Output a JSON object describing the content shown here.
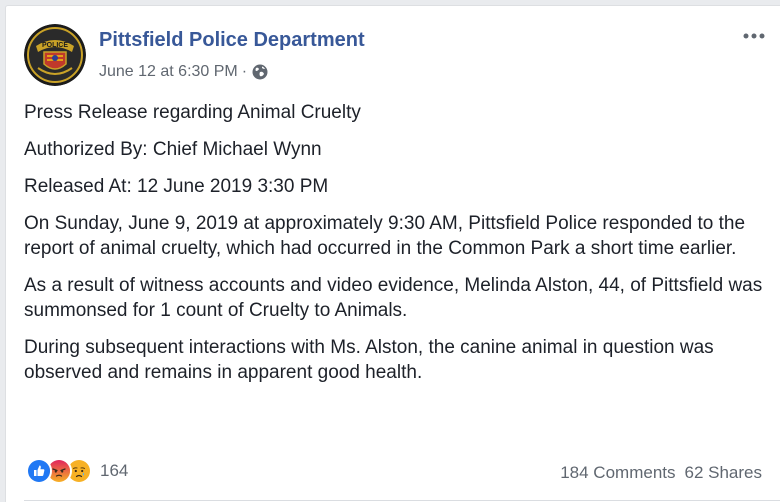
{
  "post": {
    "page_name": "Pittsfield Police Department",
    "timestamp": "June 12 at 6:30 PM",
    "separator": "·",
    "privacy_icon": "globe-icon",
    "more_icon": "more-options-icon",
    "avatar_text": "POLICE",
    "paragraphs": [
      "Press Release regarding Animal Cruelty",
      "Authorized By: Chief Michael Wynn",
      "Released At: 12 June 2019 3:30 PM",
      "On Sunday, June 9, 2019 at approximately 9:30 AM, Pittsfield Police responded to the report of animal cruelty, which had occurred in the Common Park a short time earlier.",
      "As a result of witness accounts and video evidence, Melinda Alston, 44, of Pittsfield was summonsed for 1 count of Cruelty to Animals.",
      "During subsequent interactions with Ms. Alston, the canine animal in question was observed and remains in apparent good health."
    ]
  },
  "footer": {
    "reactions": [
      "like-icon",
      "angry-icon",
      "sad-icon"
    ],
    "reaction_count": "164",
    "comments": "184 Comments",
    "shares": "62 Shares"
  },
  "colors": {
    "brand": "#385898",
    "meta": "#606770",
    "text": "#1d2129",
    "like": "#2078f4",
    "angry": "#e9710f",
    "sad": "#f7b125"
  }
}
